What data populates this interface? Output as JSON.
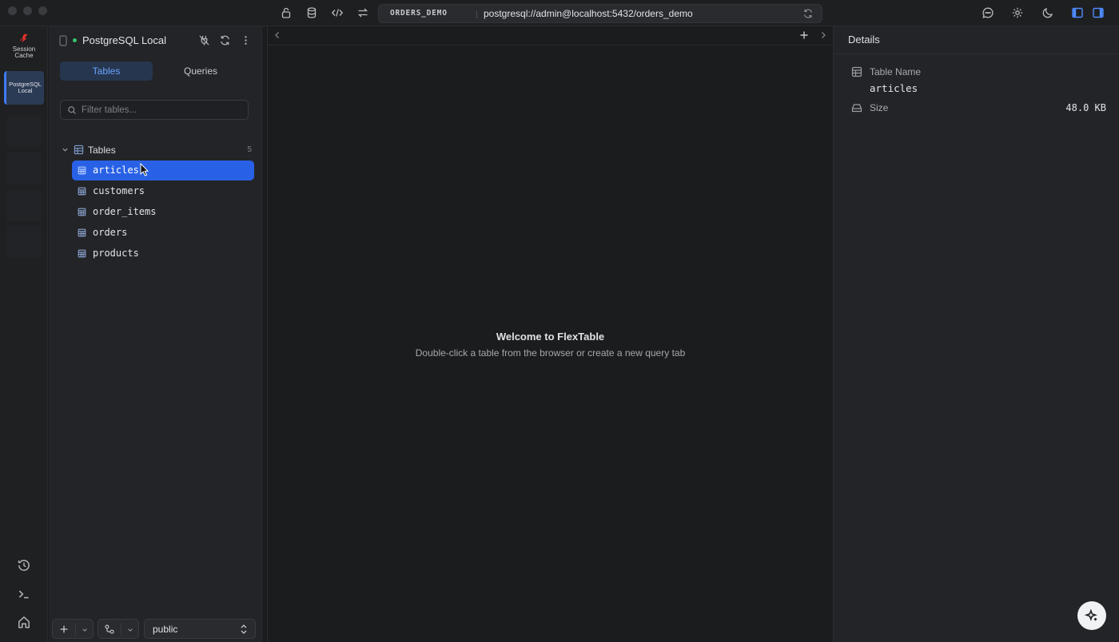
{
  "titlebar": {
    "connection_badge": "ORDERS_DEMO",
    "connection_url": "postgresql://admin@localhost:5432/orders_demo",
    "icons": [
      "lock-icon",
      "database-icon",
      "code-icon",
      "swap-icon",
      "refresh-icon",
      "chat-icon",
      "gear-icon",
      "moon-icon",
      "sidebar-left-icon",
      "sidebar-right-icon"
    ]
  },
  "rail": {
    "logo_label": "Session\nCache",
    "active_connection_label": "PostgreSQL\nLocal",
    "bottom_icons": [
      "history-icon",
      "terminal-icon",
      "home-icon"
    ]
  },
  "sidebar": {
    "connection_name": "PostgreSQL Local",
    "connection_status": "connected",
    "tabs": [
      {
        "label": "Tables",
        "active": true
      },
      {
        "label": "Queries",
        "active": false
      }
    ],
    "filter_placeholder": "Filter tables...",
    "tree": {
      "group_label": "Tables",
      "count": "5",
      "items": [
        {
          "label": "articles",
          "selected": true
        },
        {
          "label": "customers",
          "selected": false
        },
        {
          "label": "order_items",
          "selected": false
        },
        {
          "label": "orders",
          "selected": false
        },
        {
          "label": "products",
          "selected": false
        }
      ]
    },
    "footer": {
      "add_label": "+",
      "schema_value": "public"
    }
  },
  "main": {
    "welcome_title": "Welcome to FlexTable",
    "welcome_subtitle": "Double-click a table from the browser or create a new query tab"
  },
  "details": {
    "title": "Details",
    "table_name_label": "Table Name",
    "table_name_value": "articles",
    "size_label": "Size",
    "size_value": "48.0 KB"
  },
  "colors": {
    "accent": "#2861e6",
    "tab_active_text": "#6aa3ff",
    "status_connected": "#35c36b",
    "brand_logo": "#e5322d"
  }
}
